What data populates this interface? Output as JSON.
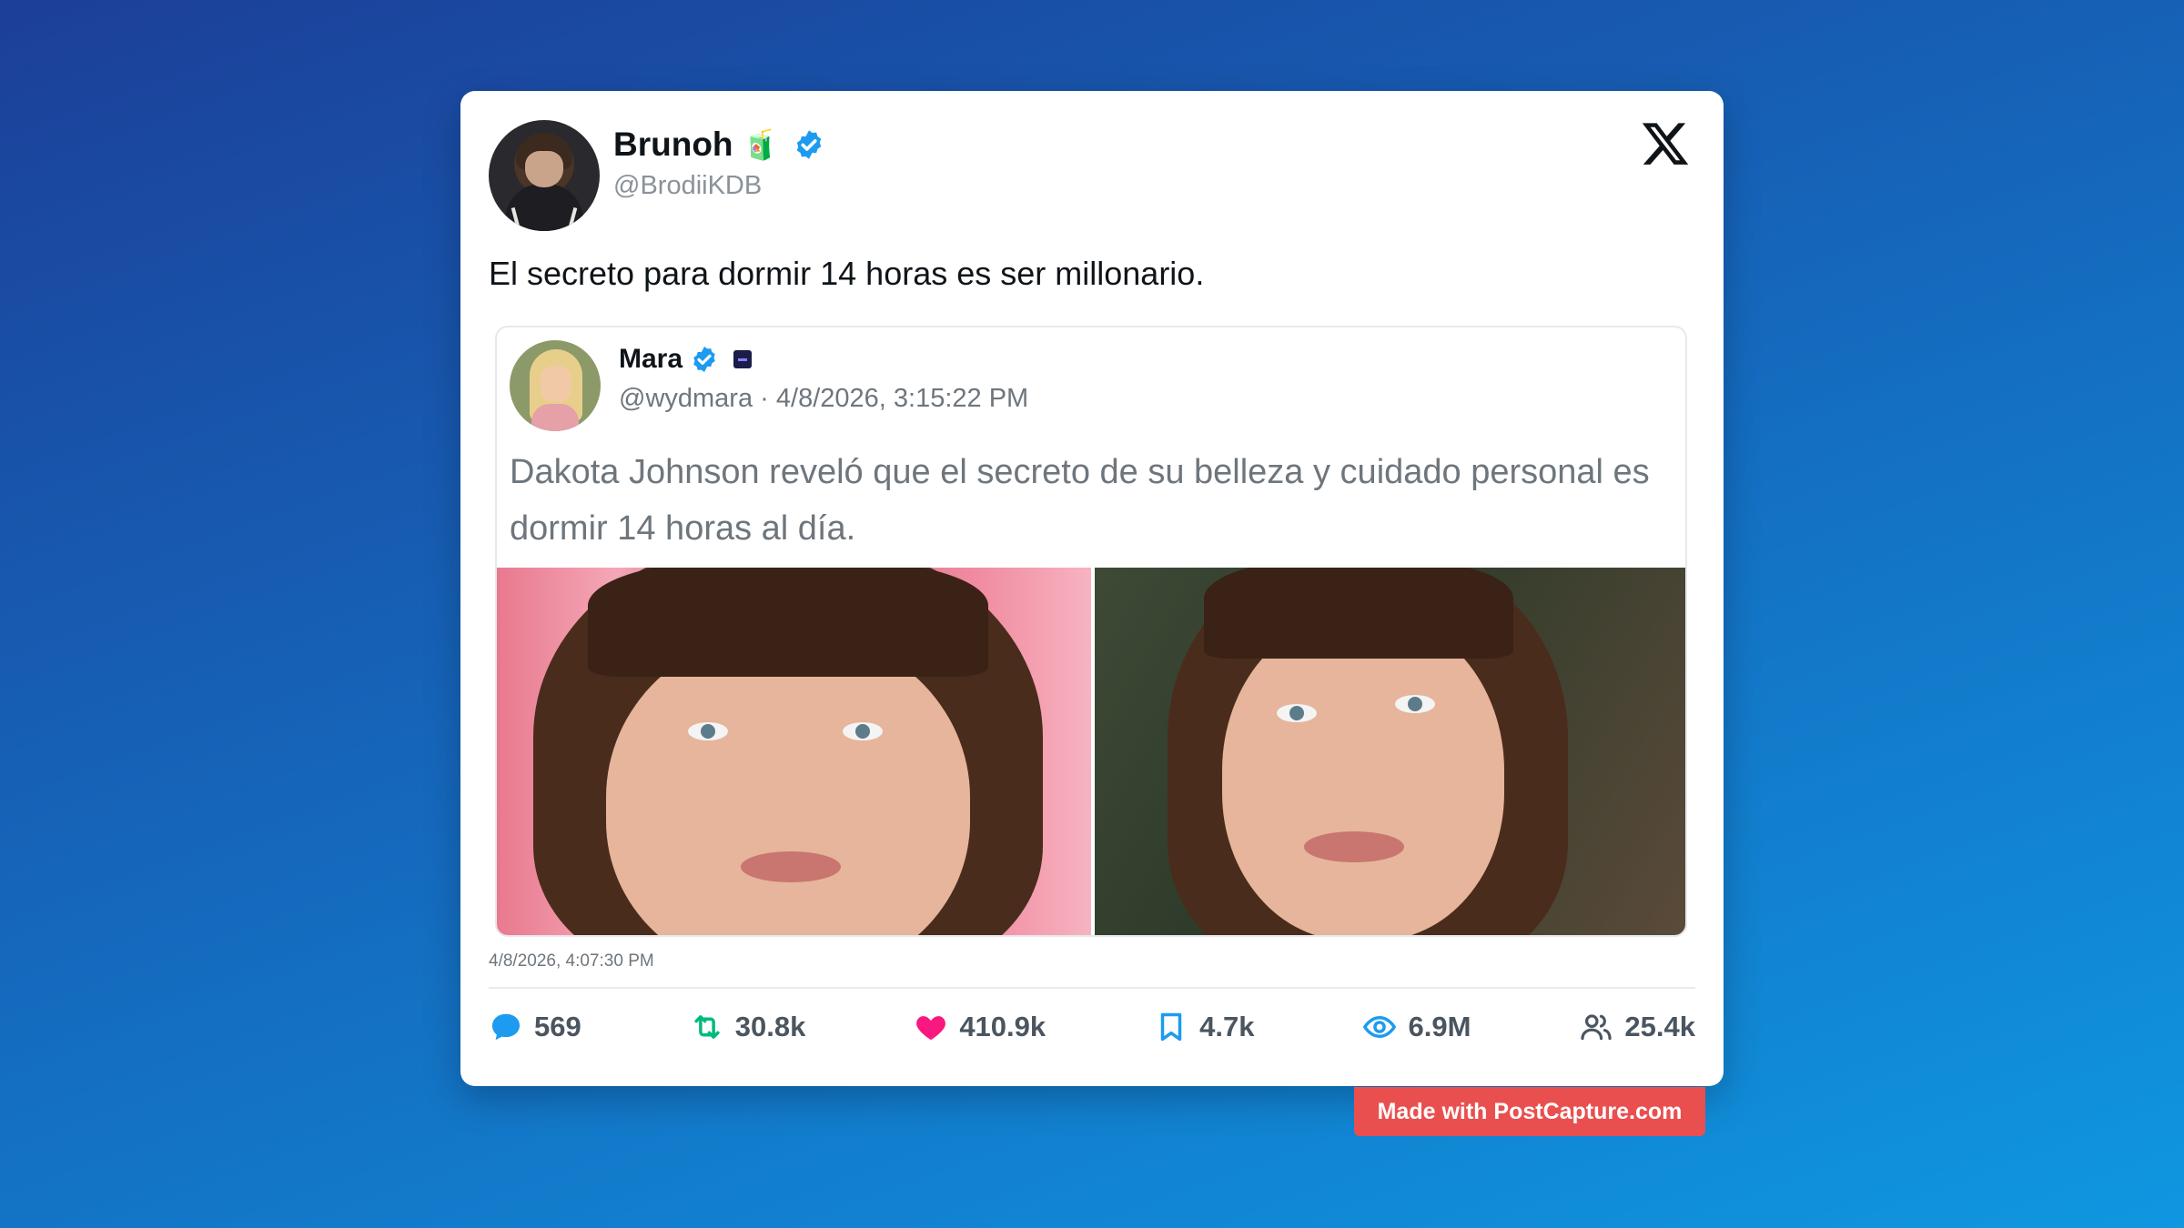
{
  "author": {
    "display_name": "Brunoh",
    "emoji": "🧃",
    "handle": "@BrodiiKDB",
    "verified": true
  },
  "tweet": {
    "text": "El secreto para dormir 14 horas es ser millonario.",
    "timestamp": "4/8/2026, 4:07:30 PM"
  },
  "quoted": {
    "display_name": "Mara",
    "handle": "@wydmara",
    "separator": "·",
    "timestamp": "4/8/2026, 3:15:22 PM",
    "text": "Dakota Johnson reveló que el secreto de su belleza y cuidado personal es dormir 14 horas al día."
  },
  "stats": {
    "replies": "569",
    "retweets": "30.8k",
    "likes": "410.9k",
    "bookmarks": "4.7k",
    "views": "6.9M",
    "followers": "25.4k"
  },
  "colors": {
    "verified": "#1d9bf0",
    "reply": "#1d9bf0",
    "retweet": "#00ba7c",
    "like": "#f91880",
    "bookmark": "#1d9bf0",
    "views": "#1d9bf0",
    "badge": "#ea4f4f"
  },
  "watermark": "Made with PostCapture.com"
}
